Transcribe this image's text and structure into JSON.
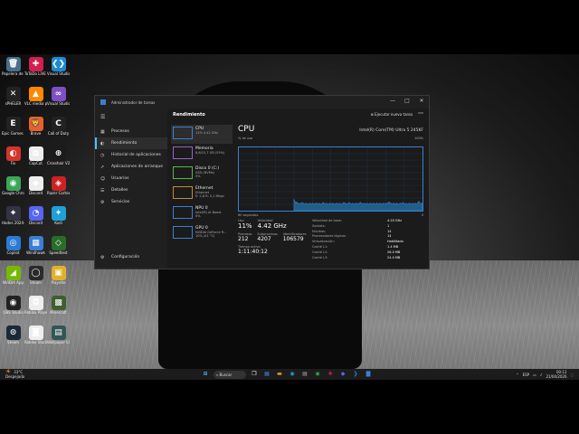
{
  "desktop": {
    "icons": [
      {
        "label": "Papelera de reciclaje",
        "glyph": "🗑",
        "color": "#4a6f8a",
        "col": 0,
        "row": 0
      },
      {
        "label": "ToToDo LiVE Studio",
        "glyph": "✚",
        "color": "#d21f4f",
        "col": 1,
        "row": 0
      },
      {
        "label": "Visual Studio Code",
        "glyph": "❮❯",
        "color": "#1f8ad2",
        "col": 2,
        "row": 0
      },
      {
        "label": "sPHELER",
        "glyph": "✕",
        "color": "#222",
        "col": 0,
        "row": 1
      },
      {
        "label": "VLC media player",
        "glyph": "▲",
        "color": "#ff8800",
        "col": 1,
        "row": 1
      },
      {
        "label": "Visual Studio",
        "glyph": "∞",
        "color": "#7d4fc4",
        "col": 2,
        "row": 1
      },
      {
        "label": "Epic Games Launcher",
        "glyph": "E",
        "color": "#222",
        "col": 0,
        "row": 2
      },
      {
        "label": "Brave",
        "glyph": "🦁",
        "color": "#e8602c",
        "col": 1,
        "row": 2
      },
      {
        "label": "Call of Duty",
        "glyph": "C",
        "color": "#222",
        "col": 2,
        "row": 2
      },
      {
        "label": "Fix",
        "glyph": "◐",
        "color": "#d4342c",
        "col": 0,
        "row": 3
      },
      {
        "label": "CapCut",
        "glyph": "⧉",
        "color": "#eee",
        "col": 1,
        "row": 3
      },
      {
        "label": "Crosshair V2",
        "glyph": "⊕",
        "color": "#1b1b1b",
        "col": 2,
        "row": 3
      },
      {
        "label": "Google Chrome",
        "glyph": "◉",
        "color": "#3aa757",
        "col": 0,
        "row": 4
      },
      {
        "label": "Discord",
        "glyph": "◆",
        "color": "#eee",
        "col": 1,
        "row": 4
      },
      {
        "label": "Razer Cortex",
        "glyph": "◈",
        "color": "#cc2222",
        "col": 2,
        "row": 4
      },
      {
        "label": "Hades 2024-2025-2",
        "glyph": "⌖",
        "color": "#334",
        "col": 0,
        "row": 5
      },
      {
        "label": "Discord",
        "glyph": "◔",
        "color": "#5865f2",
        "col": 1,
        "row": 5
      },
      {
        "label": "Kodi",
        "glyph": "✦",
        "color": "#1fa0d9",
        "col": 2,
        "row": 5
      },
      {
        "label": "Copilot",
        "glyph": "◎",
        "color": "#2b7bd4",
        "col": 0,
        "row": 6
      },
      {
        "label": "Windhawk",
        "glyph": "▦",
        "color": "#3b7fd4",
        "col": 1,
        "row": 6
      },
      {
        "label": "Speedtest",
        "glyph": "◇",
        "color": "#2a6c2a",
        "col": 2,
        "row": 6
      },
      {
        "label": "NVIDIA App",
        "glyph": "◢",
        "color": "#76b900",
        "col": 0,
        "row": 7
      },
      {
        "label": "Steam",
        "glyph": "◯",
        "color": "#2a2a2a",
        "col": 1,
        "row": 7
      },
      {
        "label": "Playnite",
        "glyph": "▣",
        "color": "#e2b12a",
        "col": 2,
        "row": 7
      },
      {
        "label": "OBS Studio",
        "glyph": "◉",
        "color": "#222",
        "col": 0,
        "row": 8
      },
      {
        "label": "Roblox Player",
        "glyph": "◘",
        "color": "#eee",
        "col": 1,
        "row": 8
      },
      {
        "label": "Minecraft",
        "glyph": "▩",
        "color": "#3f5f2f",
        "col": 2,
        "row": 8
      },
      {
        "label": "Steam",
        "glyph": "⊙",
        "color": "#1b2838",
        "col": 0,
        "row": 9
      },
      {
        "label": "Roblox Studio",
        "glyph": "◙",
        "color": "#eee",
        "col": 1,
        "row": 9
      },
      {
        "label": "Wallpaper Engine",
        "glyph": "▤",
        "color": "#355",
        "col": 2,
        "row": 9
      }
    ]
  },
  "window": {
    "title": "Administrador de tareas",
    "controls": {
      "minimize": "—",
      "maximize": "□",
      "close": "✕"
    },
    "menu_glyph": "☰",
    "nav": [
      {
        "label": "Procesos",
        "glyph": "▦"
      },
      {
        "label": "Rendimiento",
        "glyph": "◐",
        "active": true
      },
      {
        "label": "Historial de aplicaciones",
        "glyph": "◷"
      },
      {
        "label": "Aplicaciones de arranque",
        "glyph": "➚"
      },
      {
        "label": "Usuarios",
        "glyph": "☺"
      },
      {
        "label": "Detalles",
        "glyph": "☰"
      },
      {
        "label": "Servicios",
        "glyph": "⚙"
      }
    ],
    "settings": {
      "label": "Configuración",
      "glyph": "⚙"
    },
    "section_title": "Rendimiento",
    "run_task": "Ejecutar nueva tarea",
    "more_glyph": "⋯"
  },
  "perf_list": [
    {
      "name": "CPU",
      "sub": "11% 4,42 GHz",
      "color": "#3b7fd4",
      "cls": ""
    },
    {
      "name": "Memoria",
      "sub": "8,6/15,7 GB (55%)",
      "color": "#9b5fc7",
      "cls": "p"
    },
    {
      "name": "Disco 0 (C:)",
      "sub": "SSD (NVMe)\n0%",
      "color": "#5ab54a",
      "cls": "g"
    },
    {
      "name": "Ethernet",
      "sub": "Ethernet\nE: 2,8 R: 0,1 Mbps",
      "color": "#c8892c",
      "cls": "o"
    },
    {
      "name": "NPU 0",
      "sub": "Intel(R) AI Boost\n0%",
      "color": "#3b7fd4",
      "cls": ""
    },
    {
      "name": "GPU 0",
      "sub": "NVIDIA GeForce R...\n10% (41 °C)",
      "color": "#3b7fd4",
      "cls": ""
    }
  ],
  "cpu": {
    "title": "CPU",
    "model": "Intel(R) Core(TM) Ultra 5 245KF",
    "util_label": "% de uso",
    "util_max": "100%",
    "time_label": "60 segundos",
    "time_end": "0",
    "utilization_series": [
      0,
      0,
      0,
      0,
      0,
      0,
      0,
      0,
      0,
      0,
      0,
      0,
      0,
      0,
      0,
      0,
      0,
      0,
      0,
      0,
      0,
      0,
      0,
      0,
      0,
      0,
      0,
      0,
      0,
      0,
      0,
      0,
      0,
      0,
      0,
      0,
      0,
      0,
      0,
      0,
      0,
      0,
      0,
      0,
      0,
      0,
      0,
      0,
      0,
      0,
      0,
      0,
      0,
      0,
      0,
      0,
      0,
      0,
      0,
      0,
      0,
      0,
      0,
      0,
      0,
      0,
      0,
      0,
      0,
      0,
      0,
      0,
      0,
      0,
      0,
      0,
      0,
      0,
      0,
      0,
      0,
      0,
      0,
      0,
      0,
      0,
      0,
      0,
      0,
      0,
      0,
      0,
      0,
      0,
      0,
      0,
      0,
      0,
      0,
      0,
      0,
      0,
      0,
      0,
      0,
      0,
      0,
      0,
      0,
      0,
      0,
      0,
      0,
      0,
      0,
      0,
      0,
      0,
      0,
      0,
      0,
      0,
      0,
      0,
      0,
      0,
      0,
      0,
      0,
      0,
      0,
      0,
      0,
      0,
      0,
      0,
      0,
      0,
      0,
      0,
      0,
      0,
      0,
      0,
      0,
      0,
      0,
      0,
      0,
      0,
      0,
      0,
      0,
      0,
      0,
      0,
      0,
      0,
      0,
      0,
      0,
      0,
      0,
      0,
      0,
      0,
      0,
      0,
      0,
      0,
      0,
      0,
      0,
      0,
      0,
      0,
      0,
      0,
      0,
      0,
      0,
      0,
      0,
      0,
      0,
      0,
      0,
      0,
      0,
      0,
      0,
      0,
      0,
      0,
      0,
      0,
      0,
      0,
      0,
      0
    ],
    "utilization_recent": [
      18,
      15,
      12,
      14,
      11,
      12,
      10,
      12,
      11,
      13,
      12,
      11,
      10,
      12,
      11,
      10,
      11,
      12,
      11,
      10,
      12,
      11,
      10,
      11,
      12,
      11,
      10,
      12,
      11,
      10,
      11,
      12,
      13,
      11,
      10,
      12,
      11,
      10,
      11,
      12,
      11,
      10,
      12,
      11,
      10,
      11,
      12,
      11,
      10,
      12,
      11,
      10,
      11,
      12,
      13,
      11,
      12,
      10,
      11,
      12,
      13,
      11,
      10,
      12,
      11,
      10,
      11,
      12,
      11,
      10,
      12,
      11,
      13,
      12,
      11,
      10,
      12,
      11,
      10,
      12,
      11,
      10,
      11,
      12,
      11,
      10,
      12,
      11,
      10,
      11,
      12,
      11,
      10,
      12,
      11,
      10,
      11,
      12,
      11,
      10,
      12,
      11,
      13,
      14,
      11,
      12,
      10,
      11,
      12,
      11,
      10,
      12,
      11,
      10,
      11,
      12,
      11,
      12,
      13,
      11,
      10,
      12,
      11,
      10,
      11,
      12,
      11,
      10,
      12,
      11,
      10,
      12,
      11,
      10,
      13,
      15,
      12,
      11,
      12,
      11
    ],
    "stats": {
      "utilization": {
        "label": "Uso",
        "value": "11%"
      },
      "speed": {
        "label": "Velocidad",
        "value": "4.42 GHz"
      },
      "processes": {
        "label": "Procesos",
        "value": "212"
      },
      "threads": {
        "label": "Subprocesos",
        "value": "4207"
      },
      "handles": {
        "label": "Identificadores",
        "value": "106579"
      },
      "uptime": {
        "label": "Tiempo activo",
        "value": "1:11:40:12"
      }
    },
    "specs": [
      {
        "k": "Velocidad de base:",
        "v": "4.20 GHz"
      },
      {
        "k": "Sockets:",
        "v": "1"
      },
      {
        "k": "Núcleos:",
        "v": "14"
      },
      {
        "k": "Procesadores lógicos:",
        "v": "14"
      },
      {
        "k": "Virtualización:",
        "v": "Habilitado"
      },
      {
        "k": "Caché L1:",
        "v": "1.4 MB"
      },
      {
        "k": "Caché L2:",
        "v": "26.0 MB"
      },
      {
        "k": "Caché L3:",
        "v": "24.0 MB"
      }
    ]
  },
  "taskbar": {
    "weather_temp": "33°C",
    "weather_text": "Despejado",
    "search_label": "Buscar",
    "lang": "ESP",
    "time": "00:12",
    "date": "21/04/2026"
  },
  "colors": {
    "accent": "#4cc2ff",
    "cpu_line": "#3b7fd4",
    "cpu_fill": "#1e5e87"
  }
}
